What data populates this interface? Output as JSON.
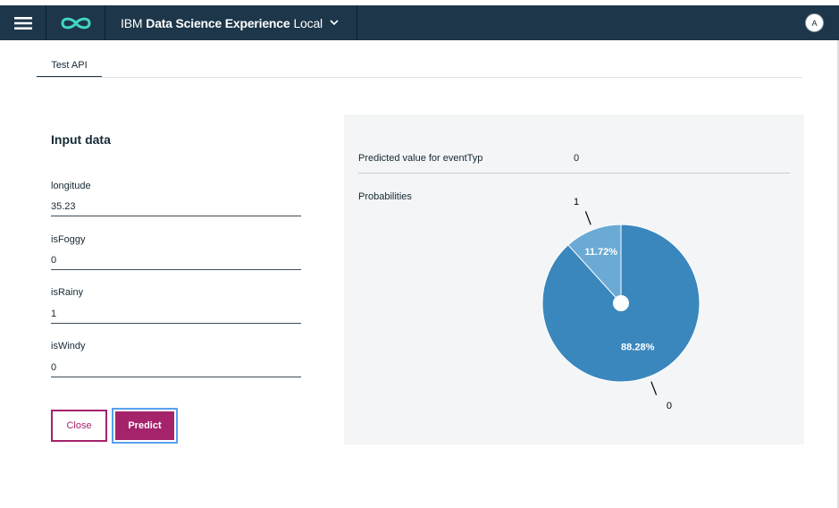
{
  "header": {
    "brand": "IBM",
    "product_bold": "Data Science Experience",
    "edition": "Local",
    "avatar_initial": "A",
    "icons": {
      "menu": "hamburger-menu-icon",
      "logo": "infinity-logo-icon",
      "dropdown": "chevron-down-icon"
    }
  },
  "tabs": [
    {
      "label": "Test API",
      "active": true
    }
  ],
  "input": {
    "title": "Input data",
    "fields": [
      {
        "label": "longitude",
        "value": "35.23"
      },
      {
        "label": "isFoggy",
        "value": "0"
      },
      {
        "label": "isRainy",
        "value": "1"
      },
      {
        "label": "isWindy",
        "value": "0"
      }
    ],
    "close_label": "Close",
    "predict_label": "Predict"
  },
  "result": {
    "predicted_label": "Predicted value for eventTyp",
    "predicted_value": "0",
    "probabilities_label": "Probabilities"
  },
  "colors": {
    "header_bg": "#1d3649",
    "accent": "#a5236b",
    "slice_0": "#3a87bd",
    "slice_1": "#6aaad5"
  },
  "chart_data": {
    "type": "pie",
    "slices": [
      {
        "category": "0",
        "value": 88.28,
        "label": "88.28%"
      },
      {
        "category": "1",
        "value": 11.72,
        "label": "11.72%"
      }
    ]
  }
}
